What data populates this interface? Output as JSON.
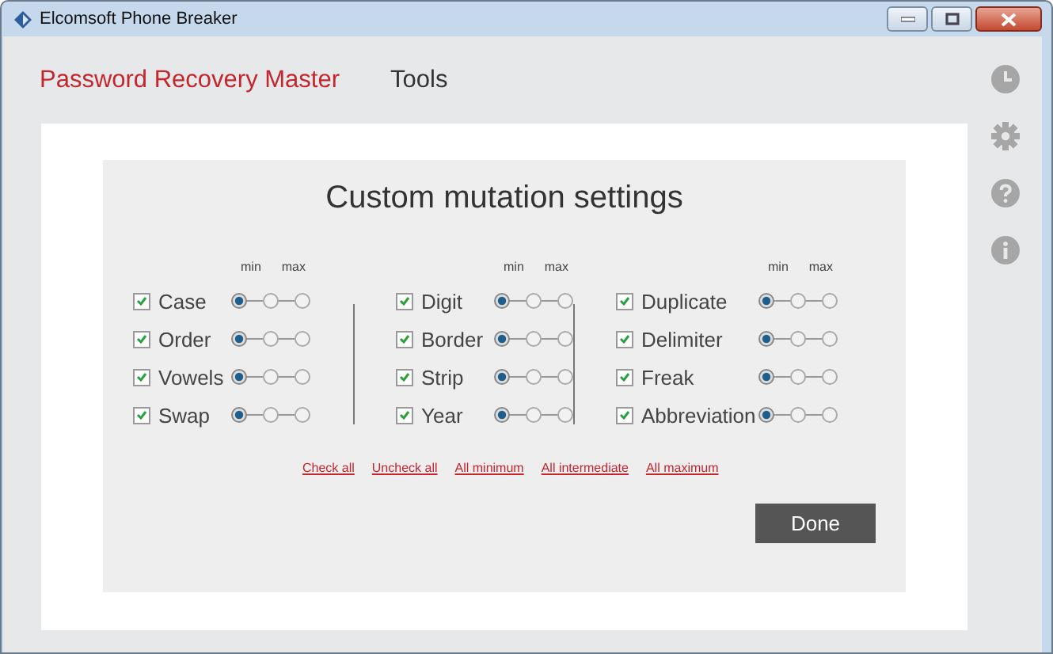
{
  "window": {
    "title": "Elcomsoft Phone Breaker"
  },
  "tabs": [
    {
      "label": "Password Recovery Master",
      "selected": true
    },
    {
      "label": "Tools",
      "selected": false
    }
  ],
  "dialog": {
    "title": "Custom mutation settings",
    "scale_labels": [
      [
        "min",
        "max"
      ],
      [
        "min",
        "max"
      ],
      [
        "min",
        "max"
      ]
    ],
    "columns": [
      {
        "options": [
          {
            "label": "Case",
            "checked": true,
            "level": 0
          },
          {
            "label": "Order",
            "checked": true,
            "level": 0
          },
          {
            "label": "Vowels",
            "checked": true,
            "level": 0
          },
          {
            "label": "Swap",
            "checked": true,
            "level": 0
          }
        ]
      },
      {
        "options": [
          {
            "label": "Digit",
            "checked": true,
            "level": 0
          },
          {
            "label": "Border",
            "checked": true,
            "level": 0
          },
          {
            "label": "Strip",
            "checked": true,
            "level": 0
          },
          {
            "label": "Year",
            "checked": true,
            "level": 0
          }
        ]
      },
      {
        "options": [
          {
            "label": "Duplicate",
            "checked": true,
            "level": 0
          },
          {
            "label": "Delimiter",
            "checked": true,
            "level": 0
          },
          {
            "label": "Freak",
            "checked": true,
            "level": 0
          },
          {
            "label": "Abbreviation",
            "checked": true,
            "level": 0
          }
        ]
      }
    ],
    "links": [
      "Check all",
      "Uncheck all",
      "All minimum",
      "All intermediate",
      "All maximum"
    ],
    "done_button": "Done"
  },
  "sidebar": [
    {
      "kind": "history"
    },
    {
      "kind": "settings"
    },
    {
      "kind": "help"
    },
    {
      "kind": "info"
    }
  ]
}
